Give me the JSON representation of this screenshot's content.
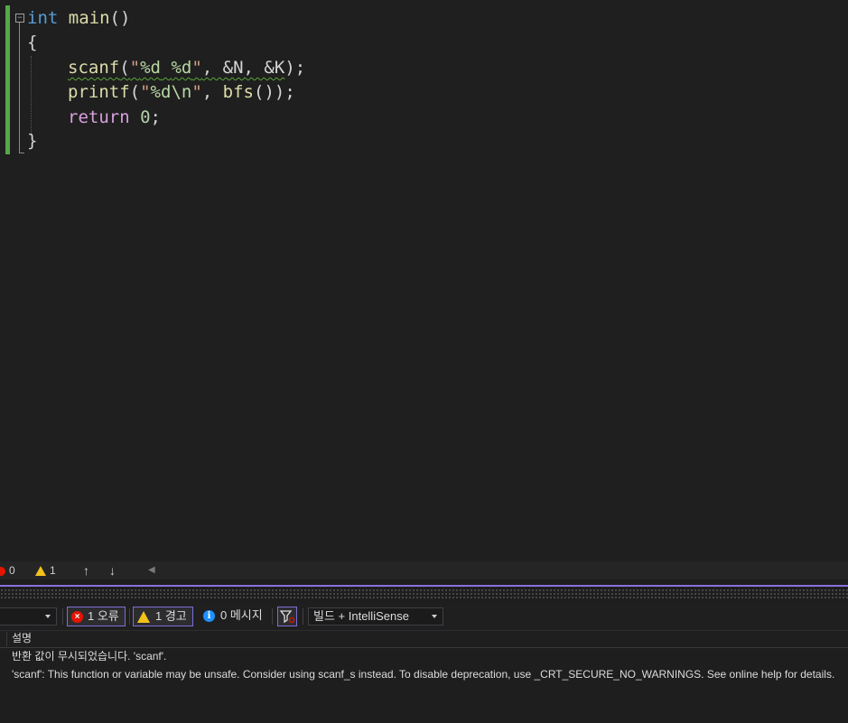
{
  "editor": {
    "code": {
      "line1": {
        "kw": "int",
        "name": "main",
        "parens": "()"
      },
      "line2": "{",
      "line3": {
        "fn": "scanf",
        "open": "(",
        "q1": "\"",
        "fmt1": "%d",
        "sp": " ",
        "fmt2": "%d",
        "q2": "\"",
        "args": ", &N, &K",
        "close": ");"
      },
      "line4": {
        "fn": "printf",
        "open": "(",
        "q1": "\"",
        "fmt1": "%d",
        "esc": "\\n",
        "q2": "\"",
        "comma": ", ",
        "call": "bfs",
        "close": "());"
      },
      "line5": {
        "kw": "return",
        "sp": " ",
        "num": "0",
        "semi": ";"
      },
      "line6": "}"
    },
    "status": {
      "error_count": "0",
      "warning_count": "1"
    }
  },
  "error_list": {
    "toolbar": {
      "errors_label": "1 오류",
      "warnings_label": "1 경고",
      "messages_label": "0 메시지",
      "source_filter": "빌드 + IntelliSense"
    },
    "columns": [
      "설명"
    ],
    "rows": [
      "반환 값이 무시되었습니다. 'scanf'.",
      "'scanf': This function or variable may be unsafe. Consider using scanf_s instead. To disable deprecation, use _CRT_SECURE_NO_WARNINGS. See online help for details."
    ]
  },
  "colors": {
    "accent": "#8a6fe0",
    "error": "#e51400",
    "warning": "#f2c21b",
    "info": "#1e90ff",
    "change_bar": "#57a64a"
  }
}
